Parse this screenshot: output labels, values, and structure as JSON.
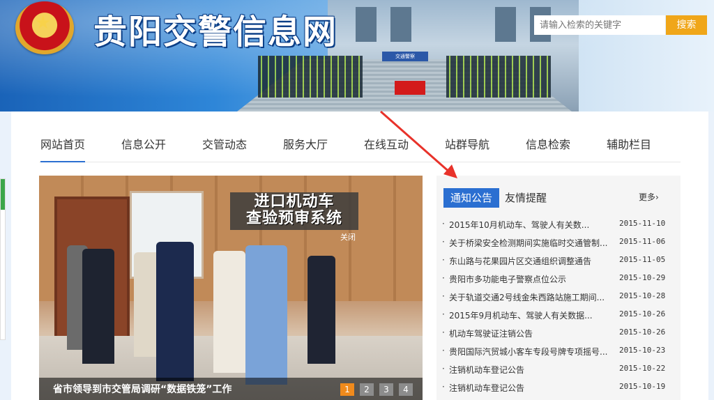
{
  "header": {
    "site_title": "贵阳交警信息网",
    "emblem_icon": "police-emblem-icon",
    "banner_gate_text": "交通警察",
    "search": {
      "placeholder": "请输入检索的关键字",
      "button_label": "搜索"
    }
  },
  "nav": {
    "items": [
      {
        "label": "网站首页",
        "active": true
      },
      {
        "label": "信息公开"
      },
      {
        "label": "交管动态"
      },
      {
        "label": "服务大厅"
      },
      {
        "label": "在线互动"
      },
      {
        "label": "站群导航"
      },
      {
        "label": "信息检索"
      },
      {
        "label": "辅助栏目"
      }
    ]
  },
  "slideshow": {
    "sign_line1": "进口机动车",
    "sign_line2": "查验预审系统",
    "close_label": "关闭",
    "caption": "省市领导到市交管局调研“数据铁笼”工作",
    "pages": [
      "1",
      "2",
      "3",
      "4"
    ],
    "active_page": "1"
  },
  "news": {
    "tabs": [
      "通知公告",
      "友情提醒"
    ],
    "more_label": "更多",
    "items": [
      {
        "title": "2015年10月机动车、驾驶人有关数...",
        "date": "2015-11-10"
      },
      {
        "title": "关于桥梁安全检测期间实施临时交通管制...",
        "date": "2015-11-06"
      },
      {
        "title": "东山路与花果园片区交通组织调整通告",
        "date": "2015-11-05"
      },
      {
        "title": "贵阳市多功能电子警察点位公示",
        "date": "2015-10-29"
      },
      {
        "title": "关于轨道交通2号线金朱西路站施工期间...",
        "date": "2015-10-28"
      },
      {
        "title": "2015年9月机动车、驾驶人有关数据...",
        "date": "2015-10-26"
      },
      {
        "title": "机动车驾驶证注销公告",
        "date": "2015-10-26"
      },
      {
        "title": "贵阳国际汽贸城小客车专段号牌专项摇号...",
        "date": "2015-10-23"
      },
      {
        "title": "注销机动车登记公告",
        "date": "2015-10-22"
      },
      {
        "title": "注销机动车登记公告",
        "date": "2015-10-19"
      }
    ]
  },
  "colors": {
    "accent": "#2b6fd1",
    "search_button": "#f0a619",
    "active_dot": "#f08a1c",
    "annotation_arrow": "#e8322a"
  }
}
